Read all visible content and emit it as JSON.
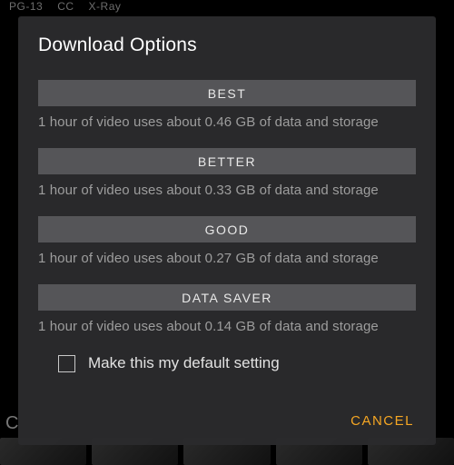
{
  "background": {
    "rating": "PG-13",
    "cc": "CC",
    "xray": "X-Ray",
    "letter": "C"
  },
  "modal": {
    "title": "Download Options",
    "options": [
      {
        "label": "BEST",
        "desc": "1 hour of video uses about 0.46 GB of data and storage"
      },
      {
        "label": "BETTER",
        "desc": "1 hour of video uses about 0.33 GB of data and storage"
      },
      {
        "label": "GOOD",
        "desc": "1 hour of video uses about 0.27 GB of data and storage"
      },
      {
        "label": "DATA SAVER",
        "desc": "1 hour of video uses about 0.14 GB of data and storage"
      }
    ],
    "default_checkbox_label": "Make this my default setting",
    "default_checked": false,
    "cancel": "CANCEL"
  }
}
